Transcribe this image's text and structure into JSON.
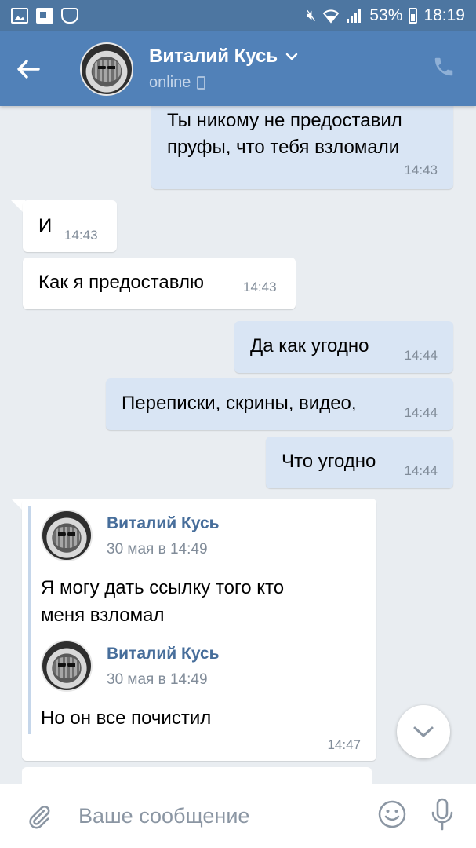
{
  "status_bar": {
    "battery": "53%",
    "time": "18:19"
  },
  "header": {
    "name": "Виталий Кусь",
    "status": "online"
  },
  "messages": [
    {
      "dir": "out",
      "text_line1": "Ты никому не предоставил",
      "text_line2": "пруфы, что  тебя взломали",
      "time": "14:43"
    },
    {
      "dir": "in",
      "text": "И",
      "time": "14:43"
    },
    {
      "dir": "in",
      "text": "Как я предоставлю",
      "time": "14:43"
    },
    {
      "dir": "out",
      "text": "Да как угодно",
      "time": "14:44"
    },
    {
      "dir": "out",
      "text": "Переписки, скрины, видео,",
      "time": "14:44"
    },
    {
      "dir": "out",
      "text": "Что угодно",
      "time": "14:44"
    }
  ],
  "forwarded": {
    "items": [
      {
        "author": "Виталий Кусь",
        "date": "30 мая в 14:49",
        "text_line1": "Я могу дать ссылку того кто",
        "text_line2": "меня взломал"
      },
      {
        "author": "Виталий Кусь",
        "date": "30 мая в 14:49",
        "text_line1": "Но он все почистил"
      }
    ],
    "time": "14:47"
  },
  "input": {
    "placeholder": "Ваше сообщение"
  },
  "colors": {
    "header": "#5181b8",
    "outgoing_bubble": "#d9e5f4",
    "chat_bg": "#e9edf1"
  }
}
